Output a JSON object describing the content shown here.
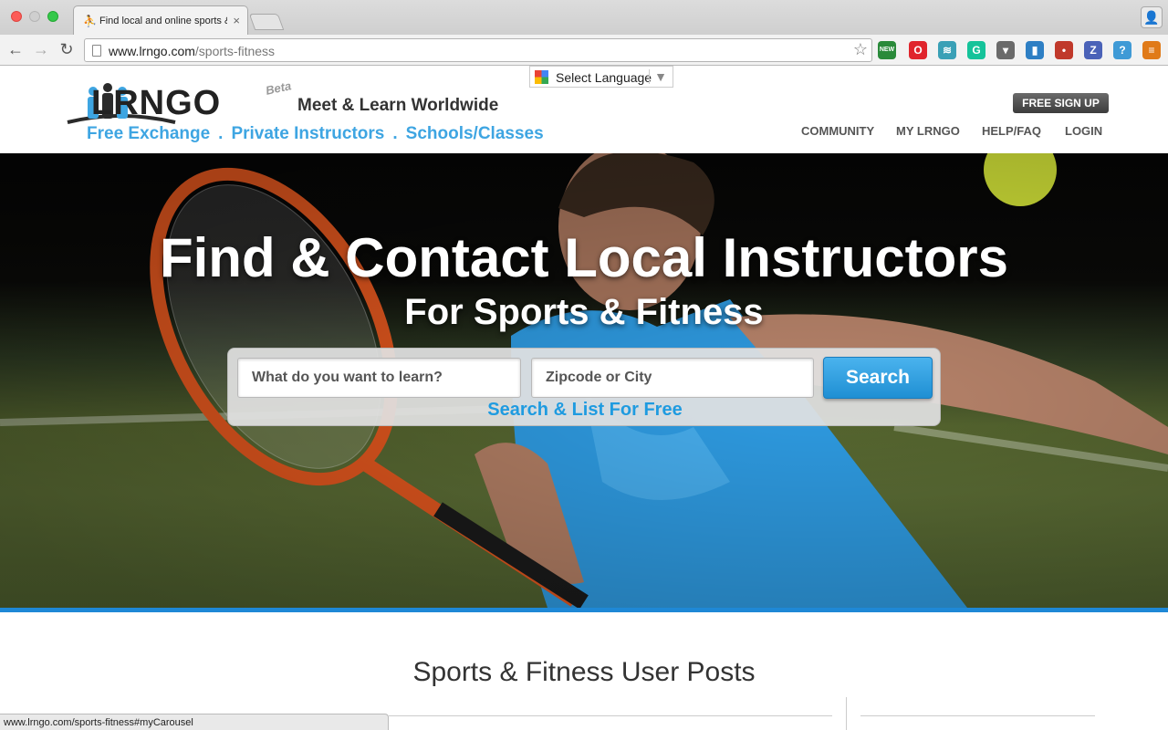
{
  "browser": {
    "tab_title": "Find local and online sports & fitness",
    "url_host": "www.lrngo.com",
    "url_path": "/sports-fitness",
    "status_url": "www.lrngo.com/sports-fitness#myCarousel",
    "extensions": [
      {
        "name": "new-extension-icon",
        "label": "NEW",
        "color": "#2a8a3a"
      },
      {
        "name": "opera-extension-icon",
        "label": "O",
        "color": "#e0242c"
      },
      {
        "name": "wave-extension-icon",
        "label": "≋",
        "color": "#3aa0b6"
      },
      {
        "name": "grammarly-extension-icon",
        "label": "G",
        "color": "#15c39a"
      },
      {
        "name": "pocket-extension-icon",
        "label": "▾",
        "color": "#6a6a6a"
      },
      {
        "name": "shirt-extension-icon",
        "label": "▮",
        "color": "#2e7fc4"
      },
      {
        "name": "wifi-extension-icon",
        "label": "•",
        "color": "#c0392b"
      },
      {
        "name": "z-extension-icon",
        "label": "Z",
        "color": "#4a62b8"
      },
      {
        "name": "help-extension-icon",
        "label": "?",
        "color": "#3f9ad6"
      },
      {
        "name": "menu-extension-icon",
        "label": "≡",
        "color": "#e07a18"
      }
    ]
  },
  "header": {
    "language_label": "Select Language",
    "logo_text": "LRNGO",
    "logo_beta": "Beta",
    "tagline": "Meet & Learn Worldwide",
    "sublinks": [
      "Free Exchange",
      "Private Instructors",
      "Schools/Classes"
    ],
    "sublink_separator": ".",
    "signup_label": "FREE SIGN UP",
    "nav": [
      "COMMUNITY",
      "MY LRNGO",
      "HELP/FAQ",
      "LOGIN"
    ]
  },
  "hero": {
    "title": "Find & Contact Local Instructors",
    "subtitle": "For Sports & Fitness",
    "search_what_placeholder": "What do you want to learn?",
    "search_where_placeholder": "Zipcode or City",
    "search_button": "Search",
    "list_link": "Search & List For Free",
    "accent_color": "#1e88d6"
  },
  "main": {
    "section_title": "Sports & Fitness User Posts"
  }
}
